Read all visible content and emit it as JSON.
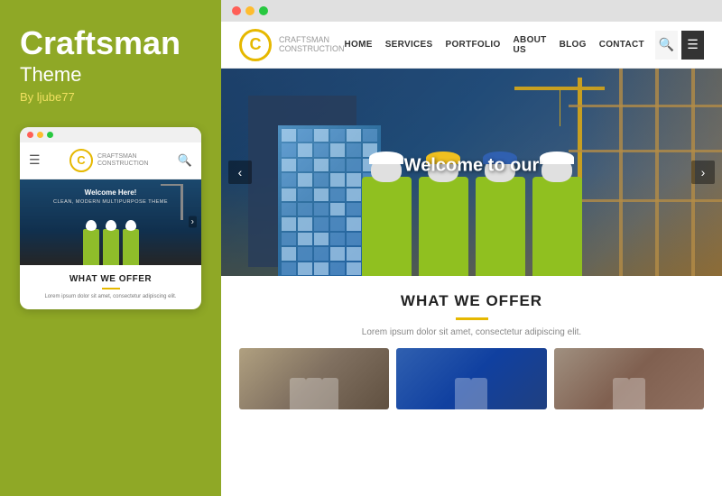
{
  "left": {
    "title": "Craftsman",
    "subtitle": "Theme",
    "author": "By ljube77",
    "mobile_preview": {
      "logo_letter": "C",
      "logo_name": "CRAFTSMAN",
      "logo_sub": "CONSTRUCTION",
      "hero_text": "Welcome Here!",
      "hero_subtext": "CLEAN, MODERN MULTIPURPOSE THEME",
      "what_we_offer": "WHAT WE OFFER",
      "description": "Lorem ipsum dolor sit amet, consectetur adipiscing elit."
    }
  },
  "right": {
    "browser_dots": [
      "red",
      "yellow",
      "green"
    ],
    "site": {
      "logo_letter": "C",
      "logo_name": "CRAFTSMAN",
      "logo_sub": "CONSTRUCTION",
      "nav": {
        "items": [
          "HOME",
          "SERVICES",
          "PORTFOLIO",
          "ABOUT US",
          "BLOG",
          "CONTACT"
        ]
      },
      "hero": {
        "welcome_text": "Welcome to our",
        "arrow_left": "‹",
        "arrow_right": "›"
      },
      "offer": {
        "title": "WHAT WE OFFER",
        "description": "Lorem ipsum dolor sit amet, consectetur adipiscing elit.",
        "divider_color": "#e6b800"
      }
    }
  }
}
